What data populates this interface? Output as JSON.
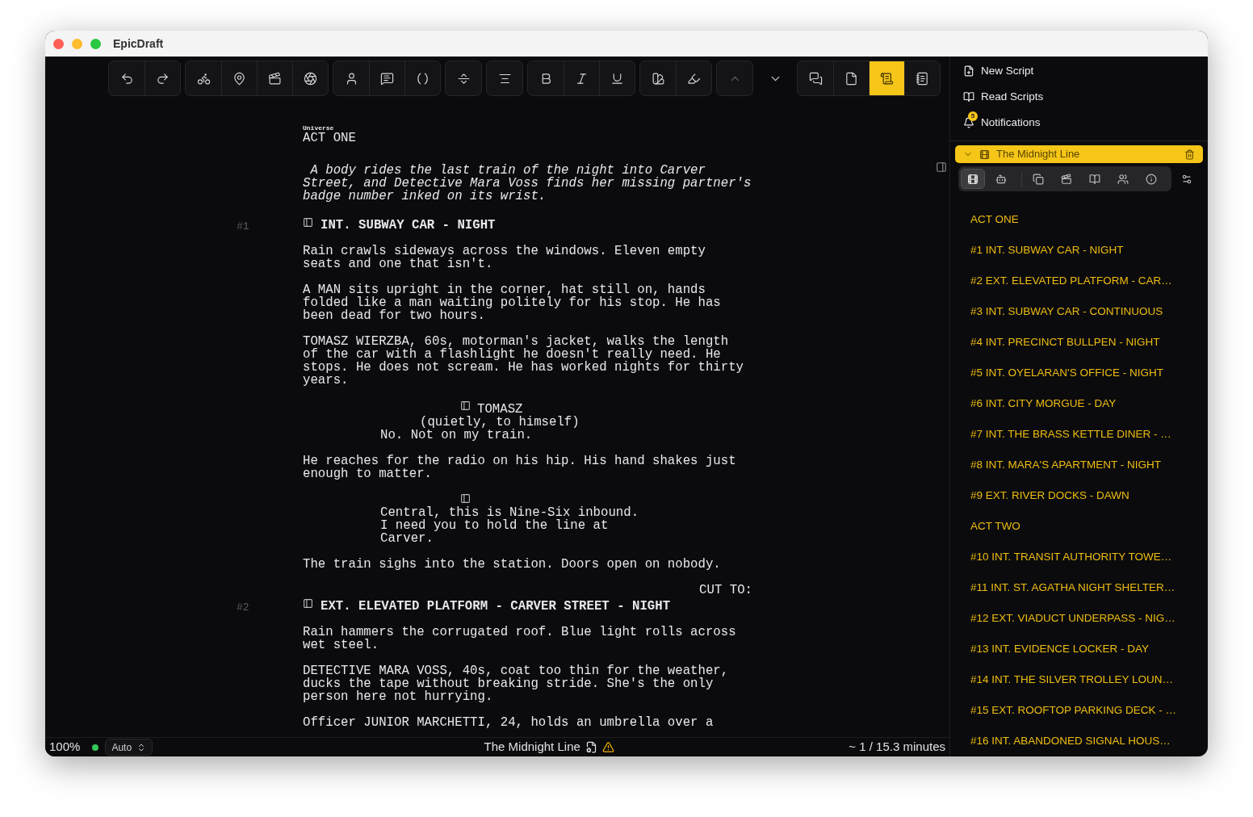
{
  "window": {
    "title": "EpicDraft"
  },
  "toolbar": {
    "groups": [
      {
        "buttons": [
          {
            "selected": false,
            "disabled": false
          },
          {
            "selected": false,
            "disabled": false
          }
        ]
      },
      {
        "buttons": [
          {
            "selected": false,
            "disabled": false
          },
          {
            "selected": false,
            "disabled": false
          },
          {
            "selected": false,
            "disabled": false
          },
          {
            "selected": false,
            "disabled": false
          }
        ]
      },
      {
        "buttons": [
          {
            "selected": false,
            "disabled": false
          },
          {
            "selected": false,
            "disabled": false
          },
          {
            "selected": false,
            "disabled": false
          }
        ]
      },
      {
        "buttons": [
          {
            "selected": false,
            "disabled": false
          }
        ]
      },
      {
        "buttons": [
          {
            "selected": false,
            "disabled": false
          }
        ]
      },
      {
        "buttons": [
          {
            "selected": false,
            "disabled": false
          },
          {
            "selected": false,
            "disabled": false
          },
          {
            "selected": false,
            "disabled": false
          }
        ]
      },
      {
        "buttons": [
          {
            "selected": false,
            "disabled": false
          },
          {
            "selected": false,
            "disabled": false
          }
        ]
      },
      {
        "buttons": [
          {
            "selected": false,
            "disabled": true
          }
        ]
      },
      {
        "plain": true,
        "buttons": [
          {
            "selected": false,
            "disabled": false
          }
        ]
      },
      {
        "buttons": [
          {
            "selected": false,
            "disabled": false
          },
          {
            "selected": false,
            "disabled": false
          },
          {
            "selected": true,
            "disabled": false
          },
          {
            "selected": false,
            "disabled": false
          }
        ]
      }
    ]
  },
  "script": {
    "blocks": [
      {
        "kind": "label",
        "text": "Universe"
      },
      {
        "kind": "act",
        "text": "ACT ONE"
      },
      {
        "kind": "synopsis",
        "lines": [
          " A body rides the last train of the night into Carver",
          "Street, and Detective Mara Voss finds her missing partner's",
          "badge number inked on its wrist."
        ]
      },
      {
        "kind": "scene",
        "number": "#1",
        "text": "INT. SUBWAY CAR - NIGHT"
      },
      {
        "kind": "action",
        "lines": [
          "Rain crawls sideways across the windows. Eleven empty",
          "seats and one that isn't."
        ]
      },
      {
        "kind": "action",
        "lines": [
          "A MAN sits upright in the corner, hat still on, hands",
          "folded like a man waiting politely for his stop. He has",
          "been dead for two hours."
        ]
      },
      {
        "kind": "action",
        "lines": [
          "TOMASZ WIERZBA, 60s, motorman's jacket, walks the length",
          "of the car with a flashlight he doesn't really need. He",
          "stops. He does not scream. He has worked nights for thirty",
          "years."
        ]
      },
      {
        "kind": "character",
        "text": "TOMASZ"
      },
      {
        "kind": "parenthetical",
        "text": "(quietly, to himself)"
      },
      {
        "kind": "dialogue",
        "lines": [
          "No. Not on my train."
        ]
      },
      {
        "kind": "action",
        "lines": [
          "He reaches for the radio on his hip. His hand shakes just",
          "enough to matter."
        ]
      },
      {
        "kind": "marker"
      },
      {
        "kind": "dialogue",
        "lines": [
          "Central, this is Nine-Six inbound.",
          "I need you to hold the line at",
          "Carver."
        ]
      },
      {
        "kind": "action",
        "lines": [
          "The train sighs into the station. Doors open on nobody."
        ]
      },
      {
        "kind": "transition",
        "text": "CUT TO:"
      },
      {
        "kind": "scene",
        "number": "#2",
        "text": "EXT. ELEVATED PLATFORM - CARVER STREET - NIGHT"
      },
      {
        "kind": "action",
        "lines": [
          "Rain hammers the corrugated roof. Blue light rolls across",
          "wet steel."
        ]
      },
      {
        "kind": "action",
        "lines": [
          "DETECTIVE MARA VOSS, 40s, coat too thin for the weather,",
          "ducks the tape without breaking stride. She's the only",
          "person here not hurrying."
        ]
      },
      {
        "kind": "action",
        "lines": [
          "Officer JUNIOR MARCHETTI, 24, holds an umbrella over a"
        ]
      }
    ]
  },
  "status_bar": {
    "zoom": "100%",
    "connected": true,
    "mode": "Auto",
    "title": "The Midnight Line",
    "warning": true,
    "duration": "~ 1 / 15.3 minutes"
  },
  "sidebar": {
    "menu": [
      {
        "label": "New Script"
      },
      {
        "label": "Read Scripts"
      },
      {
        "label": "Notifications",
        "badge": "5"
      }
    ],
    "project": {
      "title": "The Midnight Line",
      "expanded": true
    },
    "tabs": [
      {
        "selected": true
      },
      {
        "selected": false
      },
      {
        "selected": false
      },
      {
        "selected": false
      },
      {
        "selected": false
      },
      {
        "selected": false
      },
      {
        "selected": false
      }
    ],
    "outline": [
      {
        "kind": "act",
        "title": "ACT ONE"
      },
      {
        "kind": "scene",
        "number": "#1",
        "title": "INT. SUBWAY CAR - NIGHT"
      },
      {
        "kind": "scene",
        "number": "#2",
        "title": "EXT. ELEVATED PLATFORM - CAR…"
      },
      {
        "kind": "scene",
        "number": "#3",
        "title": "INT. SUBWAY CAR - CONTINUOUS"
      },
      {
        "kind": "scene",
        "number": "#4",
        "title": "INT. PRECINCT BULLPEN - NIGHT"
      },
      {
        "kind": "scene",
        "number": "#5",
        "title": "INT. OYELARAN'S OFFICE - NIGHT"
      },
      {
        "kind": "scene",
        "number": "#6",
        "title": "INT. CITY MORGUE - DAY"
      },
      {
        "kind": "scene",
        "number": "#7",
        "title": "INT. THE BRASS KETTLE DINER - …"
      },
      {
        "kind": "scene",
        "number": "#8",
        "title": "INT. MARA'S APARTMENT - NIGHT"
      },
      {
        "kind": "scene",
        "number": "#9",
        "title": "EXT. RIVER DOCKS - DAWN"
      },
      {
        "kind": "act",
        "title": "ACT TWO"
      },
      {
        "kind": "scene",
        "number": "#10",
        "title": "INT. TRANSIT AUTHORITY TOWE…"
      },
      {
        "kind": "scene",
        "number": "#11",
        "title": "INT. ST. AGATHA NIGHT SHELTER…"
      },
      {
        "kind": "scene",
        "number": "#12",
        "title": "EXT. VIADUCT UNDERPASS - NIG…"
      },
      {
        "kind": "scene",
        "number": "#13",
        "title": "INT. EVIDENCE LOCKER - DAY"
      },
      {
        "kind": "scene",
        "number": "#14",
        "title": "INT. THE SILVER TROLLEY LOUN…"
      },
      {
        "kind": "scene",
        "number": "#15",
        "title": "EXT. ROOFTOP PARKING DECK - …"
      },
      {
        "kind": "scene",
        "number": "#16",
        "title": "INT. ABANDONED SIGNAL HOUS…"
      }
    ]
  }
}
